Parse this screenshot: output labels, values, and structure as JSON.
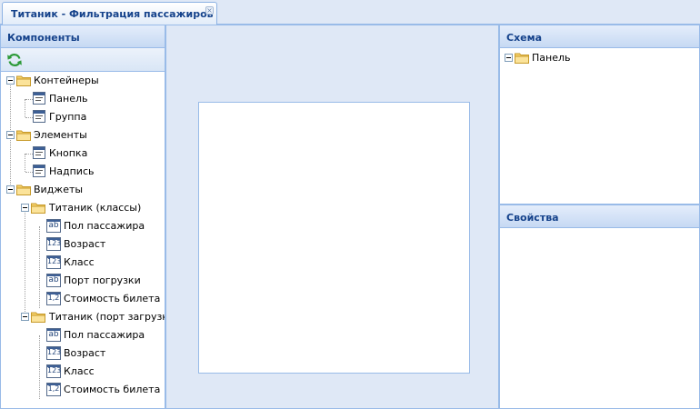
{
  "window_tab": {
    "title": "Титаник - Фильтрация пассажиров",
    "close": "×"
  },
  "components_panel": {
    "title": "Компоненты",
    "tree": {
      "containers": {
        "label": "Контейнеры",
        "items": [
          "Панель",
          "Группа"
        ]
      },
      "elements": {
        "label": "Элементы",
        "items": [
          "Кнопка",
          "Надпись"
        ]
      },
      "widgets": {
        "label": "Виджеты",
        "groups": [
          {
            "label": "Титаник (классы)",
            "items": [
              "Пол пассажира",
              "Возраст",
              "Класс",
              "Порт погрузки",
              "Стоимость билета"
            ]
          },
          {
            "label": "Титаник (порт загрузки)",
            "items": [
              "Пол пассажира",
              "Возраст",
              "Класс",
              "Стоимость билета"
            ]
          }
        ]
      }
    }
  },
  "icon_text": {
    "string": "ab",
    "number": "123",
    "decimal": "1,2"
  },
  "schema_panel": {
    "title": "Схема",
    "root": "Панель"
  },
  "properties_panel": {
    "title": "Свойства"
  }
}
